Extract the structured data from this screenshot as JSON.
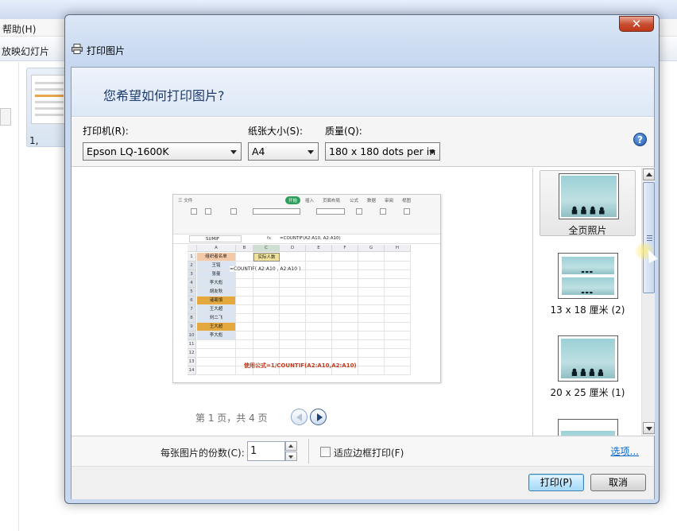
{
  "background": {
    "menu_help": "帮助(H)",
    "toolbar_slideshow": "放映幻灯片",
    "thumb_label": "1,"
  },
  "dialog": {
    "title": "打印图片",
    "close_glyph": "✕",
    "heading": "您希望如何打印图片?",
    "help_glyph": "?",
    "printer": {
      "label": "打印机(R):",
      "value": "Epson LQ-1600K"
    },
    "paper": {
      "label": "纸张大小(S):",
      "value": "A4"
    },
    "quality": {
      "label": "质量(Q):",
      "value": "180 x 180 dots per in"
    },
    "pager": "第 1 页，共 4 页",
    "layouts": [
      {
        "label": "全页照片",
        "selected": true
      },
      {
        "label": "13 x 18 厘米 (2)",
        "selected": false
      },
      {
        "label": "20 x 25 厘米 (1)",
        "selected": false
      }
    ],
    "copies_label": "每张图片的份数(C):",
    "copies_value": "1",
    "fit_frame_label": "适应边框打印(F)",
    "fit_frame_checked": false,
    "options_link": "选项...",
    "print_button": "打印(P)",
    "cancel_button": "取消"
  },
  "preview_sheet": {
    "tabs": [
      "三 文件",
      "开始",
      "插入",
      "页面布局",
      "公式",
      "数据",
      "审阅",
      "视图"
    ],
    "active_tab": "开始",
    "name_box": "SUMIF",
    "fx_label": "fx",
    "formula": "=COUNTIF(A2:A10, A2:A10)",
    "columns": [
      "A",
      "B",
      "C",
      "D",
      "E",
      "F",
      "G",
      "H"
    ],
    "rows": [
      "1",
      "2",
      "3",
      "4",
      "5",
      "6",
      "7",
      "8",
      "9",
      "10",
      "11",
      "12",
      "13",
      "14"
    ],
    "header_a": "组织者名单",
    "header_c": "实际人数",
    "names": [
      "王铭",
      "张曼",
      "李大彪",
      "胡友秋",
      "诸葛慎",
      "王大超",
      "刘二飞",
      "王大超",
      "李大彪"
    ],
    "highlight_rows": [
      6,
      9
    ],
    "cell_edit": "=COUNTIF( A2:A10 , A2:A10 )",
    "note": "使用公式=1/COUNTIF(A2:A10,A2:A10)"
  }
}
